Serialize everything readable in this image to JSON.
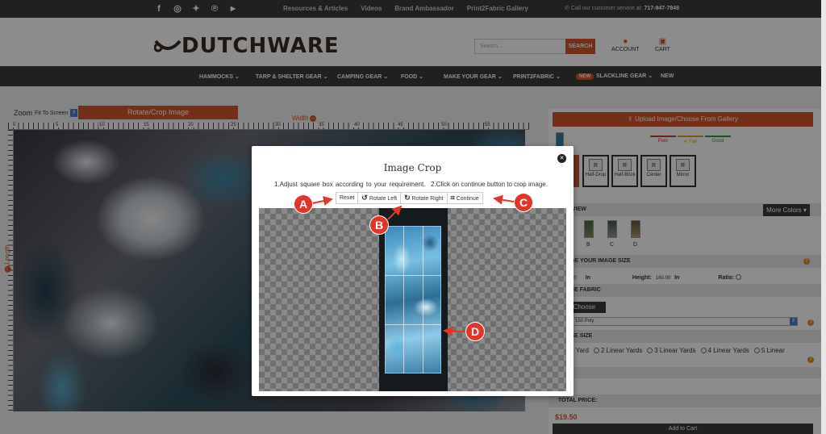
{
  "topbar": {
    "social_icons": [
      "facebook-icon",
      "instagram-icon",
      "twitter-icon",
      "pinterest-icon",
      "youtube-icon"
    ],
    "links": [
      "Resources & Articles",
      "Videos",
      "Brand Ambassador",
      "Print2Fabric Gallery"
    ],
    "phone_text": "Call our customer service at:",
    "phone_number": "717-947-7849"
  },
  "header": {
    "logo": "DUTCHWARE",
    "search_placeholder": "Search...",
    "search_button": "SEARCH",
    "account_label": "ACCOUNT",
    "cart_label": "CART"
  },
  "nav": {
    "items": [
      "HAMMOCKS",
      "TARP & SHELTER GEAR",
      "CAMPING GEAR",
      "FOOD",
      "MAKE YOUR GEAR",
      "PRINT2FABRIC",
      "SLACKLINE GEAR",
      "NEW"
    ],
    "new_badge": "NEW"
  },
  "editor": {
    "zoom_label": "Zoom",
    "zoom_value": "Fit To Screen",
    "rotate_crop_button": "Rotate/Crop Image",
    "width_label": "Width",
    "length_label": "Length",
    "ruler_numbers": [
      "0",
      "5",
      "10",
      "15",
      "20",
      "25",
      "30",
      "35",
      "40",
      "45",
      "50",
      "55"
    ]
  },
  "panel": {
    "upload_button": "Upload Image/Choose From Gallery",
    "quality": [
      {
        "label": "Poor",
        "color": "#d9342b"
      },
      {
        "label": "Fair",
        "color": "#e8a020"
      },
      {
        "label": "Good",
        "color": "#3a9a3a"
      }
    ],
    "layouts": [
      "Half-Drop",
      "Half-Brick",
      "Center",
      "Mirror"
    ],
    "view_header": "R VIEW",
    "more_colors": "More Colors",
    "swatches": [
      "B",
      "C",
      "D"
    ],
    "size_header": "NGE YOUR IMAGE SIZE",
    "width_value": "0.00",
    "width_unit": "In",
    "height_label": "Height:",
    "height_value": "160.00",
    "height_unit": "In",
    "ratio_label": "Ratio:",
    "fabric_header": "OSE FABRIC",
    "choose_button": "e Choose",
    "fabric_value": "150 Poly",
    "size_section": "OSE SIZE",
    "yards": [
      "ear Yard",
      "2 Linear Yards",
      "3 Linear Yards",
      "4 Linear Yards",
      "5 Linear"
    ],
    "total_label": "TOTAL PRICE:",
    "total_value": "$19.50",
    "add_to_cart": "Add to Cart"
  },
  "modal": {
    "title": "Image Crop",
    "instruction_1": "1.Adjust square box according to your requirement.",
    "instruction_2": "2.Click on continue button to crop image.",
    "buttons": {
      "reset": "Reset",
      "rotate_left": "Rotate Left",
      "rotate_right": "Rotate Right",
      "continue": "Continue"
    },
    "close_icon": "close-icon"
  },
  "callouts": [
    "A",
    "B",
    "C",
    "D"
  ],
  "colors": {
    "accent": "#d2572a",
    "dark": "#3b3d38",
    "callout": "#e0362a"
  }
}
